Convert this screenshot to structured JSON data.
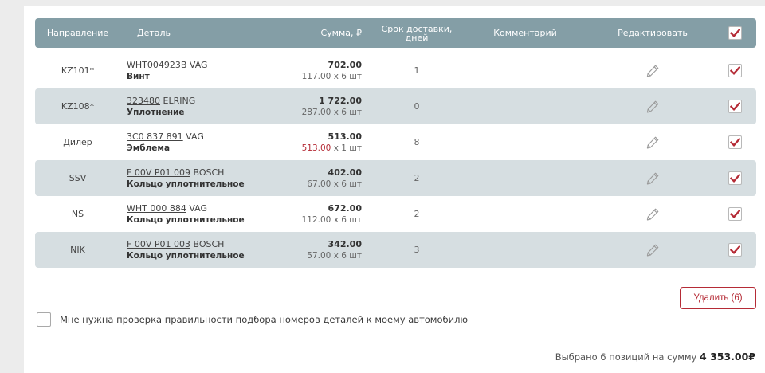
{
  "table": {
    "headers": {
      "direction": "Направление",
      "part": "Деталь",
      "sum": "Сумма, ₽",
      "delivery_line1": "Срок доставки,",
      "delivery_line2": "дней",
      "comment": "Комментарий",
      "edit": "Редактировать"
    },
    "rows": [
      {
        "direction": "KZ101*",
        "code": "WHT004923B",
        "brand": " VAG",
        "name": "Винт",
        "total": "702.00",
        "unit_price": "117.00",
        "qty": " х 6 шт",
        "delivery": "1",
        "price_red": false
      },
      {
        "direction": "KZ108*",
        "code": "323480",
        "brand": " ELRING",
        "name": "Уплотнение",
        "total": "1 722.00",
        "unit_price": "287.00",
        "qty": " х 6 шт",
        "delivery": "0",
        "price_red": false
      },
      {
        "direction": "Дилер",
        "code": "3C0 837 891",
        "brand": " VAG",
        "name": "Эмблема",
        "total": "513.00",
        "unit_price": "513.00",
        "qty": " х 1 шт",
        "delivery": "8",
        "price_red": true
      },
      {
        "direction": "SSV",
        "code": "F 00V P01 009",
        "brand": " BOSCH",
        "name": "Кольцо уплотнительное",
        "total": "402.00",
        "unit_price": "67.00",
        "qty": " х 6 шт",
        "delivery": "2",
        "price_red": false
      },
      {
        "direction": "NS",
        "code": "WHT 000 884",
        "brand": " VAG",
        "name": "Кольцо уплотнительное",
        "total": "672.00",
        "unit_price": "112.00",
        "qty": " х 6 шт",
        "delivery": "2",
        "price_red": false
      },
      {
        "direction": "NIK",
        "code": "F 00V P01 003",
        "brand": " BOSCH",
        "name": "Кольцо уплотнительное",
        "total": "342.00",
        "unit_price": "57.00",
        "qty": " х 6 шт",
        "delivery": "3",
        "price_red": false
      }
    ]
  },
  "actions": {
    "delete_label": "Удалить (6)",
    "verify_label": "Мне нужна проверка правильности подбора номеров деталей к моему автомобилю"
  },
  "summary": {
    "text": "Выбрано 6 позиций на сумму ",
    "amount": "4 353.00₽"
  },
  "colors": {
    "header_bg": "#849ea6",
    "row_alt_bg": "#d6dee1",
    "accent_red": "#b52b36"
  },
  "icons": {
    "edit": "pencil-icon",
    "check": "checkmark-icon"
  }
}
